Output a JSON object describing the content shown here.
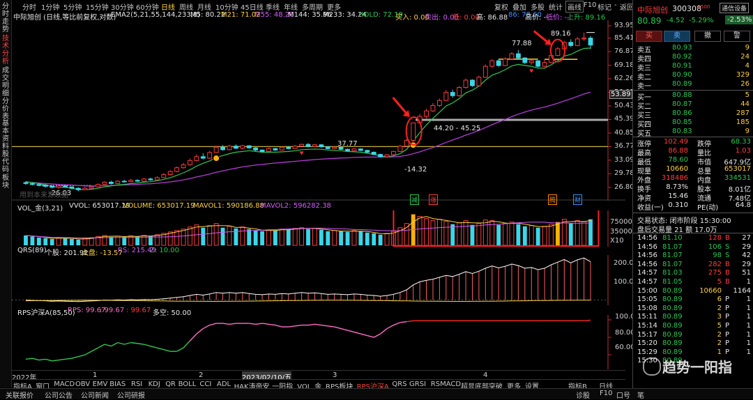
{
  "left_tabs": [
    "分时走势",
    "技术分析",
    "成交明细",
    "分价表",
    "基本资料",
    "股代码",
    "板块"
  ],
  "left_active": 1,
  "periods": [
    "分时",
    "1分钟",
    "5分钟",
    "15分钟",
    "30分钟",
    "60分钟",
    "日线",
    "周线",
    "月线",
    "10分钟",
    "45日线",
    "季线",
    "年线",
    "多周期",
    "更多"
  ],
  "period_active": 6,
  "top_buttons": [
    "复权",
    "叠加",
    "多股",
    "统计",
    "画线",
    "F10",
    "标记",
    "-",
    "返回"
  ],
  "main_header": {
    "name": "中际旭创 (日线,等比前复权,对数)",
    "ema": "EMA2(5,21,55,144,233,8)",
    "m5": "M5: 80.22",
    "m21": "M21: 71.02",
    "m55": "M55: 48.20",
    "m144": "M144: 35.96",
    "m233": "M233: 34.24",
    "hold": "HOLD: 72.19",
    "buy": "买入: 0.00",
    "sell": "卖出: 0.00",
    "low": "低: 0.00",
    "high": "高: 86.88",
    "c1": "86: 78.60",
    "c2": "高价: --",
    "c3": "低价: --",
    "c4": "上升: 89.16"
  },
  "main_scale": [
    "93.95",
    "85.41",
    "76.87",
    "69.18",
    "62.26",
    "56.03",
    "50.43",
    "45.39",
    "40.85",
    "36.77",
    "33.09",
    "29.78",
    "26.80"
  ],
  "main_scale_box": "53.89",
  "price_annotations": {
    "high1": "77.88",
    "high2": "89.16",
    "range": "44.20 - 45.25",
    "mid": "37.77",
    "low1": "-26.03",
    "low2": "-14.32"
  },
  "watermark_line": "用到本来源数据",
  "event_flags": {
    "f1": "减",
    "f2": "涨",
    "f3": "腾",
    "f4": "财"
  },
  "vol_header": {
    "t": "VOL_金(3,21)",
    "vvol": "VVOL: 653017.19",
    "vol": "VOLUME: 653017.19",
    "ma1": "MAVOL1: 590186.88",
    "ma2": "MAVOL2: 596282.38"
  },
  "vol_scale": [
    "75000",
    "35000",
    "X10"
  ],
  "qrs_header": {
    "t": "QRS(89)",
    "a": "个股: 201.92",
    "b": "大盘: -13.57",
    "c": "RS: 215.49",
    "d": "Z: 10.00"
  },
  "qrs_scale": [
    "200.0",
    "100.0"
  ],
  "rps_header": {
    "t": "RPS沪深A(85,50)",
    "a": "RPS: 99.67",
    "b": ": 99.67",
    "c": ": 99.67",
    "d": "多空: 50.00"
  },
  "rps_scale": [
    "100.0",
    "80.00",
    "60.00"
  ],
  "time_axis": [
    "2022年",
    "1",
    "2",
    "2023/02/10/五",
    "3",
    "4"
  ],
  "bottom_tabs": [
    "指标A",
    "窗口",
    "MACD",
    "OBV",
    "EMV",
    "BIAS",
    "RSI",
    "KDJ",
    "QR",
    "BOLL",
    "CCI",
    "ADL",
    "HAK涛帝安",
    "一阳指",
    "VOL_金",
    "RPS板块",
    "RPS沪深A",
    "QRS",
    "GRSI",
    "RSMACD",
    "超显底部突破",
    "更多",
    "设置"
  ],
  "bottom_tab_active": 16,
  "bottom_right": [
    "指标B",
    "日线"
  ],
  "status_items": [
    "关联报价",
    "公司公告",
    "公司新闻",
    "公司研报"
  ],
  "status_right": [
    "诊股",
    "F10",
    "口号",
    "笔"
  ],
  "stock": {
    "name": "中际旭创",
    "code": "300308",
    "badge": "R500",
    "tag": "通信设备",
    "price": "80.89",
    "change": "-4.52",
    "pct": "-5.29%",
    "rel": "-2.53%"
  },
  "trade_buttons": [
    "买",
    "卖",
    "撤",
    "警"
  ],
  "asks": [
    [
      "卖五",
      "80.93",
      "9"
    ],
    [
      "卖四",
      "80.92",
      "24"
    ],
    [
      "卖三",
      "80.91",
      "4"
    ],
    [
      "卖二",
      "80.90",
      "329"
    ],
    [
      "卖一",
      "80.89",
      "26"
    ]
  ],
  "bids": [
    [
      "买一",
      "80.88",
      "5"
    ],
    [
      "买二",
      "80.87",
      "44"
    ],
    [
      "买三",
      "80.86",
      "287"
    ],
    [
      "买四",
      "80.85",
      "185"
    ],
    [
      "买五",
      "80.83",
      "9"
    ]
  ],
  "stats": [
    [
      "涨停",
      "102.49",
      "跌停",
      "68.33"
    ],
    [
      "最高",
      "86.88",
      "量比",
      "1.03"
    ],
    [
      "最低",
      "78.60",
      "市值",
      "647.9亿"
    ],
    [
      "现量",
      "10660",
      "总量",
      "653017"
    ],
    [
      "外盘",
      "318486",
      "内盘",
      "334531"
    ],
    [
      "换手",
      "8.73%",
      "股本",
      "8.01亿"
    ],
    [
      "净资",
      "15.46",
      "流通",
      "7.48亿"
    ],
    [
      "收益(一)",
      "0.310",
      "PE(动)",
      "64.8"
    ]
  ],
  "trade_state": "交易状态: 闭市阶段 15:30:00",
  "after_hours": "盘后交易量 21 额 17.0万",
  "ticks": [
    [
      "14:56",
      "81.10",
      "128",
      "B",
      "27"
    ],
    [
      "14:56",
      "81.07",
      "106",
      "S",
      "29"
    ],
    [
      "14:56",
      "81.07",
      "98",
      "S",
      "42"
    ],
    [
      "14:56",
      "81.07",
      "282",
      "B",
      "29"
    ],
    [
      "14:57",
      "81.03",
      "275",
      "B",
      "51"
    ],
    [
      "14:57",
      "81.05",
      "5",
      "B",
      "1"
    ],
    [
      "15:00",
      "80.89",
      "10660",
      "",
      "1164"
    ],
    [
      "15:05",
      "80.89",
      "6",
      "P",
      "1"
    ],
    [
      "15:08",
      "80.89",
      "2",
      "P",
      "1"
    ],
    [
      "15:11",
      "80.89",
      "3",
      "P",
      "1"
    ],
    [
      "15:14",
      "80.89",
      "5",
      "P",
      "1"
    ],
    [
      "15:17",
      "80.89",
      "2",
      "P",
      "1"
    ],
    [
      "15:20",
      "80.89",
      "2",
      "P",
      "1"
    ],
    [
      "15:29",
      "80.89",
      "1",
      "P",
      "1"
    ],
    [
      "15:30",
      "80.89",
      "",
      "",
      ""
    ]
  ],
  "watermark": "趋势一阳指",
  "chart_data": {
    "type": "candlestick",
    "ylog": true,
    "candles": [
      [
        27.8,
        27.6,
        28.1,
        27.3
      ],
      [
        27.6,
        27.4,
        27.9,
        27.2
      ],
      [
        27.4,
        27.2,
        27.7,
        27.0
      ],
      [
        27.3,
        27.0,
        27.5,
        26.8
      ],
      [
        27.0,
        26.8,
        27.3,
        26.6
      ],
      [
        26.8,
        27.1,
        27.3,
        26.5
      ],
      [
        27.1,
        26.9,
        27.3,
        26.7
      ],
      [
        26.9,
        26.6,
        27.0,
        26.4
      ],
      [
        26.6,
        26.3,
        26.8,
        26.0
      ],
      [
        26.3,
        26.6,
        26.9,
        26.2
      ],
      [
        26.6,
        26.9,
        27.2,
        26.5
      ],
      [
        26.9,
        27.4,
        27.6,
        26.8
      ],
      [
        27.4,
        27.9,
        28.1,
        27.3
      ],
      [
        27.9,
        27.6,
        28.2,
        27.4
      ],
      [
        27.6,
        28.1,
        28.3,
        27.5
      ],
      [
        28.1,
        28.0,
        28.4,
        27.8
      ],
      [
        28.0,
        28.3,
        28.6,
        27.9
      ],
      [
        28.3,
        28.1,
        28.5,
        27.9
      ],
      [
        28.1,
        28.6,
        28.8,
        28.0
      ],
      [
        28.6,
        28.4,
        28.9,
        28.2
      ],
      [
        28.4,
        28.9,
        29.2,
        28.3
      ],
      [
        28.9,
        29.6,
        29.9,
        28.8
      ],
      [
        29.6,
        30.3,
        30.6,
        29.4
      ],
      [
        30.3,
        31.2,
        31.5,
        30.1
      ],
      [
        31.2,
        31.9,
        32.4,
        31.0
      ],
      [
        31.9,
        33.0,
        33.5,
        31.7
      ],
      [
        33.0,
        34.0,
        34.6,
        32.8
      ],
      [
        34.0,
        33.6,
        34.9,
        33.3
      ],
      [
        33.6,
        35.1,
        35.6,
        33.4
      ],
      [
        35.1,
        36.6,
        37.0,
        35.0
      ],
      [
        36.6,
        35.9,
        37.2,
        35.6
      ],
      [
        35.9,
        36.9,
        37.3,
        35.7
      ],
      [
        36.9,
        36.3,
        37.4,
        36.1
      ],
      [
        36.3,
        37.0,
        37.3,
        36.0
      ],
      [
        37.0,
        36.4,
        37.2,
        36.2
      ],
      [
        36.4,
        35.8,
        36.6,
        35.5
      ],
      [
        35.8,
        35.4,
        36.0,
        35.1
      ],
      [
        35.4,
        36.2,
        36.5,
        35.3
      ],
      [
        36.2,
        35.8,
        36.4,
        35.6
      ],
      [
        35.8,
        36.6,
        36.8,
        35.7
      ],
      [
        36.6,
        36.2,
        36.9,
        36.0
      ],
      [
        36.2,
        36.9,
        37.2,
        36.1
      ],
      [
        36.9,
        37.4,
        37.6,
        36.8
      ],
      [
        37.4,
        36.8,
        37.77,
        36.6
      ],
      [
        36.8,
        37.3,
        37.5,
        36.6
      ],
      [
        37.3,
        36.7,
        37.5,
        36.5
      ],
      [
        36.7,
        36.2,
        36.9,
        36.0
      ],
      [
        36.2,
        36.6,
        36.8,
        36.0
      ],
      [
        36.6,
        36.0,
        36.8,
        35.8
      ],
      [
        36.0,
        35.6,
        36.2,
        35.4
      ],
      [
        35.6,
        36.1,
        36.3,
        35.5
      ],
      [
        36.1,
        35.7,
        36.3,
        35.5
      ],
      [
        35.7,
        35.2,
        35.9,
        35.0
      ],
      [
        35.2,
        34.6,
        35.4,
        34.4
      ],
      [
        34.6,
        34.0,
        34.8,
        33.8
      ],
      [
        34.0,
        34.5,
        34.7,
        33.8
      ],
      [
        34.5,
        35.4,
        35.6,
        34.3
      ],
      [
        35.4,
        36.9,
        37.2,
        35.3
      ],
      [
        36.9,
        38.6,
        39.0,
        36.8
      ],
      [
        38.6,
        44.2,
        44.2,
        38.5
      ],
      [
        44.2,
        46.5,
        47.4,
        44.0
      ],
      [
        46.5,
        48.5,
        49.3,
        45.8
      ],
      [
        48.5,
        50.6,
        51.6,
        48.1
      ],
      [
        50.6,
        52.6,
        53.4,
        50.0
      ],
      [
        52.6,
        56.0,
        57.0,
        52.3
      ],
      [
        56.0,
        54.6,
        57.2,
        53.8
      ],
      [
        54.6,
        58.2,
        58.8,
        54.2
      ],
      [
        58.2,
        61.6,
        62.4,
        57.6
      ],
      [
        61.6,
        59.0,
        62.0,
        58.5
      ],
      [
        59.0,
        63.0,
        63.8,
        58.6
      ],
      [
        63.0,
        68.6,
        69.6,
        62.6
      ],
      [
        68.6,
        71.6,
        72.5,
        67.8
      ],
      [
        71.6,
        69.0,
        72.6,
        68.4
      ],
      [
        69.0,
        72.6,
        73.6,
        68.6
      ],
      [
        72.6,
        75.6,
        76.6,
        72.0
      ],
      [
        75.6,
        73.2,
        77.88,
        72.5
      ],
      [
        73.2,
        70.6,
        73.6,
        69.8
      ],
      [
        70.6,
        71.6,
        72.4,
        69.5
      ],
      [
        71.6,
        68.6,
        71.9,
        68.0
      ],
      [
        68.6,
        70.6,
        72.0,
        68.2
      ],
      [
        70.6,
        74.6,
        75.6,
        70.2
      ],
      [
        74.6,
        78.6,
        79.6,
        74.2
      ],
      [
        78.6,
        82.6,
        83.6,
        78.0
      ],
      [
        82.6,
        80.6,
        84.6,
        79.6
      ],
      [
        80.6,
        84.8,
        86.2,
        80.2
      ],
      [
        84.8,
        85.4,
        89.16,
        83.6
      ],
      [
        85.4,
        80.89,
        86.88,
        78.6
      ]
    ],
    "hline_yellow": 36.77,
    "hline_gray": 45.25,
    "line_green": [
      28.0,
      27.8,
      27.6,
      27.3,
      27.0,
      26.8,
      26.8,
      26.6,
      26.4,
      26.3,
      26.4,
      26.6,
      26.9,
      27.1,
      27.3,
      27.4,
      27.6,
      27.7,
      27.9,
      28.0,
      28.2,
      28.5,
      28.9,
      29.4,
      30.0,
      30.7,
      31.6,
      32.3,
      32.9,
      33.8,
      34.3,
      34.8,
      35.2,
      35.4,
      35.6,
      35.4,
      35.2,
      35.2,
      35.2,
      35.3,
      35.4,
      35.6,
      35.9,
      36.0,
      36.1,
      36.0,
      35.8,
      35.7,
      35.6,
      35.4,
      35.3,
      35.2,
      34.9,
      34.6,
      34.2,
      34.0,
      34.2,
      34.8,
      36.0,
      38.4,
      41.0,
      43.5,
      45.8,
      48.0,
      50.4,
      51.6,
      53.4,
      55.8,
      57.0,
      58.8,
      61.6,
      64.0,
      65.2,
      66.8,
      68.8,
      69.6,
      69.0,
      68.6,
      67.6,
      67.6,
      69.4,
      71.6,
      74.2,
      75.2,
      77.2,
      78.8,
      79.0
    ],
    "line_purple": [
      27.9,
      27.8,
      27.7,
      27.6,
      27.5,
      27.4,
      27.35,
      27.3,
      27.2,
      27.1,
      27.1,
      27.1,
      27.15,
      27.2,
      27.25,
      27.3,
      27.35,
      27.4,
      27.5,
      27.55,
      27.65,
      27.8,
      27.95,
      28.15,
      28.4,
      28.7,
      29.05,
      29.35,
      29.7,
      30.1,
      30.45,
      30.8,
      31.1,
      31.4,
      31.65,
      31.85,
      32.0,
      32.2,
      32.35,
      32.5,
      32.65,
      32.8,
      32.95,
      33.1,
      33.25,
      33.35,
      33.45,
      33.55,
      33.65,
      33.7,
      33.8,
      33.85,
      33.9,
      33.9,
      33.9,
      33.9,
      33.95,
      34.1,
      34.35,
      34.8,
      35.3,
      35.9,
      36.5,
      37.2,
      38.0,
      38.7,
      39.4,
      40.2,
      40.9,
      41.7,
      42.6,
      43.6,
      44.5,
      45.4,
      46.4,
      47.3,
      48.1,
      48.8,
      49.4,
      50.0,
      50.7,
      51.5,
      52.4,
      53.3,
      54.3,
      55.3,
      56.1
    ],
    "volume": [
      28,
      25,
      22,
      20,
      18,
      22,
      20,
      18,
      16,
      20,
      22,
      25,
      28,
      24,
      26,
      24,
      27,
      25,
      28,
      26,
      30,
      34,
      38,
      42,
      46,
      52,
      58,
      50,
      56,
      62,
      50,
      54,
      48,
      52,
      46,
      42,
      40,
      44,
      42,
      46,
      44,
      48,
      50,
      46,
      48,
      44,
      40,
      42,
      40,
      38,
      42,
      40,
      36,
      34,
      30,
      34,
      40,
      50,
      62,
      88,
      82,
      76,
      70,
      74,
      68,
      60,
      64,
      70,
      58,
      62,
      72,
      70,
      58,
      62,
      66,
      60,
      54,
      56,
      50,
      54,
      60,
      66,
      74,
      62,
      70,
      68,
      74
    ],
    "qrs": [
      0,
      -2,
      -3,
      -4,
      -6,
      -5,
      -6,
      -7,
      -8,
      -6,
      -5,
      -3,
      0,
      -1,
      1,
      0,
      2,
      1,
      3,
      2,
      4,
      7,
      10,
      14,
      18,
      24,
      30,
      26,
      32,
      40,
      36,
      40,
      36,
      40,
      34,
      30,
      28,
      32,
      30,
      34,
      32,
      36,
      40,
      36,
      38,
      34,
      30,
      32,
      30,
      28,
      32,
      30,
      26,
      24,
      20,
      24,
      30,
      40,
      54,
      80,
      96,
      104,
      110,
      120,
      130,
      124,
      136,
      150,
      140,
      152,
      168,
      180,
      170,
      178,
      190,
      182,
      168,
      172,
      160,
      168,
      186,
      200,
      214,
      196,
      212,
      222,
      202
    ],
    "rps": [
      55,
      56,
      54,
      55,
      53,
      54,
      55,
      56,
      58,
      60,
      64,
      68,
      72,
      70,
      74,
      72,
      74,
      73,
      72,
      70,
      68,
      66,
      64,
      64,
      68,
      76,
      84,
      90,
      94,
      96,
      96,
      95,
      96,
      96,
      96,
      95,
      96,
      95,
      94,
      92,
      92,
      93,
      94,
      94,
      95,
      94,
      93,
      92,
      90,
      88,
      86,
      84,
      82,
      80,
      84,
      90,
      94,
      97,
      98,
      99,
      99,
      99,
      99,
      99,
      99,
      99,
      99,
      99,
      99,
      99,
      99,
      99,
      99,
      99,
      99,
      99,
      99,
      99,
      99,
      99,
      99,
      99,
      99,
      99,
      99,
      99,
      99.67
    ]
  }
}
